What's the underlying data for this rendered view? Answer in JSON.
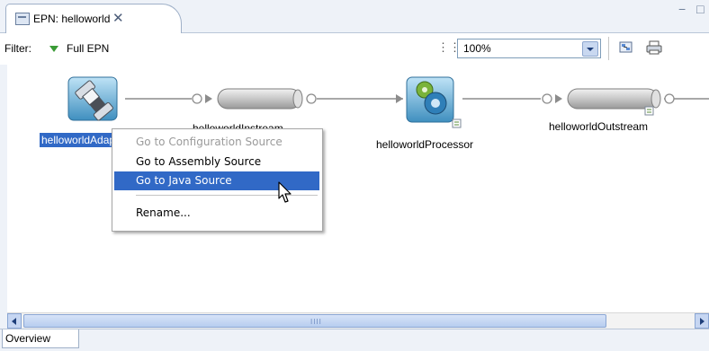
{
  "editor_tab": {
    "title": "EPN: helloworld",
    "close_glyph": "✕"
  },
  "window_controls": "− □",
  "toolbar": {
    "filter_label": "Filter:",
    "filter_value": "Full EPN",
    "zoom_value": "100%",
    "zoom_icon": "zoom-fit-icon",
    "export_icon": "export-image-icon",
    "print_icon": "print-icon"
  },
  "epn": {
    "nodes": [
      {
        "id": "adapter",
        "label": "helloworldAdapter",
        "icon": "adapter-plug-icon",
        "selected": true
      },
      {
        "id": "instream",
        "label": "helloworldInstream",
        "icon": "channel-icon"
      },
      {
        "id": "processor",
        "label": "helloworldProcessor",
        "icon": "processor-gear-icon"
      },
      {
        "id": "outstream",
        "label": "helloworldOutstream",
        "icon": "channel-icon"
      }
    ]
  },
  "context_menu": {
    "items": [
      {
        "label": "Go to Configuration Source",
        "enabled": false
      },
      {
        "label": "Go to Assembly Source",
        "enabled": true
      },
      {
        "label": "Go to Java Source",
        "enabled": true,
        "highlighted": true
      },
      {
        "label": "Rename...",
        "enabled": true
      }
    ]
  },
  "scrollbar": {
    "grip": "IIII"
  },
  "bottom_tabs": {
    "overview": "Overview"
  },
  "colors": {
    "selection": "#3169c6",
    "tab_strip": "#eef2f8",
    "filter_triangle": "#3a9b36",
    "channel_body": "#c7c7c7"
  }
}
